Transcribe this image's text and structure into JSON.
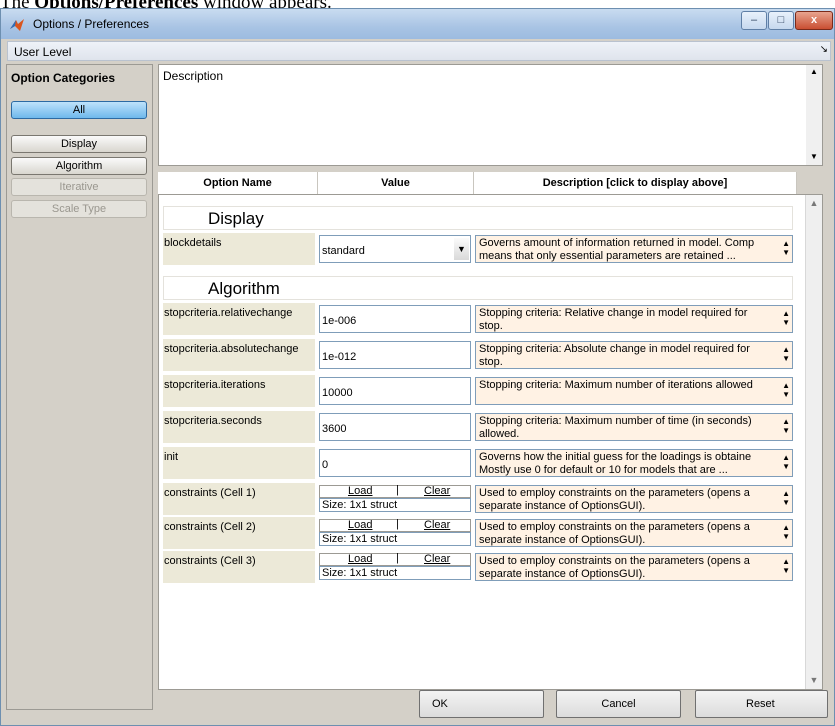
{
  "caption": {
    "prefix": "The ",
    "bold": "Options/Preferences",
    "suffix": " window appears."
  },
  "window": {
    "title": "Options / Preferences",
    "min_label": "–",
    "max_label": "□",
    "close_label": "x"
  },
  "user_level": {
    "label": "User Level",
    "arrow": "↘"
  },
  "sidebar": {
    "header": "Option Categories",
    "buttons": [
      {
        "label": "All",
        "state": "active"
      },
      {
        "label": "Display",
        "state": "normal"
      },
      {
        "label": "Algorithm",
        "state": "normal"
      },
      {
        "label": "Iterative",
        "state": "disabled"
      },
      {
        "label": "Scale Type",
        "state": "disabled"
      }
    ]
  },
  "description": {
    "label": "Description"
  },
  "columns": {
    "name": "Option Name",
    "value": "Value",
    "description": "Description [click to display above]"
  },
  "sections": [
    {
      "title": "Display"
    },
    {
      "title": "Algorithm"
    }
  ],
  "rows": [
    {
      "name": "blockdetails",
      "value": "standard",
      "desc": "Governs amount of information returned in model. Comp means that only essential parameters are retained ..."
    },
    {
      "name": "stopcriteria.relativechange",
      "value": "1e-006",
      "desc": "Stopping criteria: Relative change in model required for stop."
    },
    {
      "name": "stopcriteria.absolutechange",
      "value": "1e-012",
      "desc": "Stopping criteria: Absolute change in model required for stop."
    },
    {
      "name": "stopcriteria.iterations",
      "value": "10000",
      "desc": "Stopping criteria: Maximum number of iterations allowed"
    },
    {
      "name": "stopcriteria.seconds",
      "value": "3600",
      "desc": "Stopping criteria: Maximum number of time (in seconds) allowed."
    },
    {
      "name": "init",
      "value": "0",
      "desc": "Governs how the initial guess for the loadings is obtaine Mostly use 0 for default or 10 for models that are ..."
    },
    {
      "name": "constraints (Cell 1)",
      "load": "Load",
      "clear": "Clear",
      "size": "Size: 1x1 struct",
      "desc": "Used to employ constraints on the parameters (opens a separate instance of OptionsGUI)."
    },
    {
      "name": "constraints (Cell 2)",
      "load": "Load",
      "clear": "Clear",
      "size": "Size: 1x1 struct",
      "desc": "Used to employ constraints on the parameters (opens a separate instance of OptionsGUI)."
    },
    {
      "name": "constraints (Cell 3)",
      "load": "Load",
      "clear": "Clear",
      "size": "Size: 1x1 struct",
      "desc": "Used to employ constraints on the parameters (opens a separate instance of OptionsGUI)."
    }
  ],
  "footer": {
    "ok": "OK",
    "cancel": "Cancel",
    "reset": "Reset"
  },
  "colors": {
    "titlebar": "#a9c4e4",
    "active_button": "#6fb8ec",
    "desc_cell": "#fff2e4",
    "name_cell": "#ece9d8"
  }
}
